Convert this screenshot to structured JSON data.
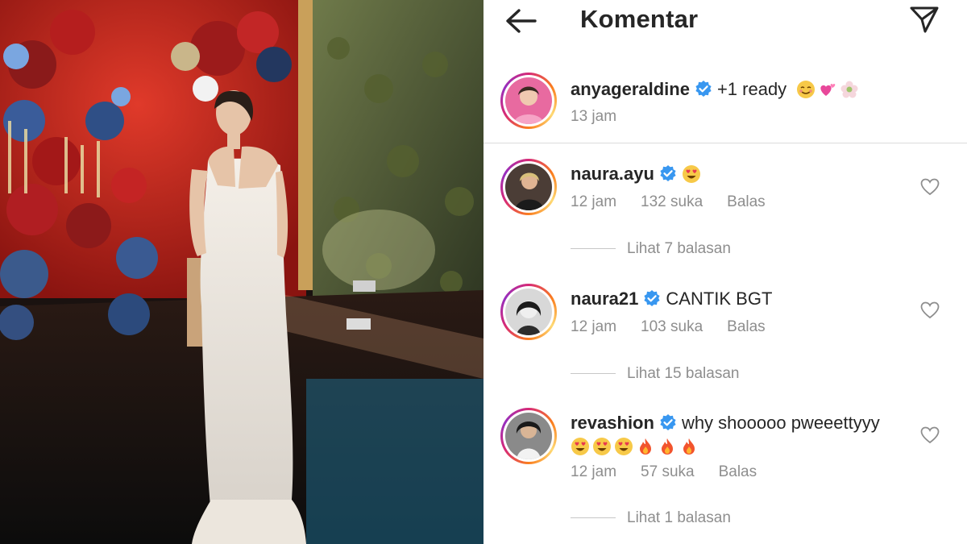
{
  "header": {
    "title": "Komentar"
  },
  "caption": {
    "username": "anyageraldine",
    "text": "+1 ready",
    "emojis": [
      "smiling-face-icon",
      "two-hearts-icon",
      "flower-icon"
    ],
    "time": "13 jam"
  },
  "comments": [
    {
      "username": "naura.ayu",
      "text": "",
      "emojis": [
        "heart-eyes-icon"
      ],
      "time": "12 jam",
      "likes": "132 suka",
      "reply_label": "Balas",
      "view_replies": "Lihat 7 balasan"
    },
    {
      "username": "naura21",
      "text": "CANTIK BGT",
      "emojis": [],
      "time": "12 jam",
      "likes": "103 suka",
      "reply_label": "Balas",
      "view_replies": "Lihat 15 balasan"
    },
    {
      "username": "revashion",
      "text": "why shooooo pweeettyyy",
      "emojis": [
        "heart-eyes-icon",
        "heart-eyes-icon",
        "heart-eyes-icon",
        "fire-icon",
        "fire-icon",
        "fire-icon"
      ],
      "time": "12 jam",
      "likes": "57 suka",
      "reply_label": "Balas",
      "view_replies": "Lihat 1 balasan"
    }
  ],
  "colors": {
    "text": "#262626",
    "muted": "#8e8e8e",
    "verified": "#3897f0",
    "divider": "#dbdbdb"
  }
}
